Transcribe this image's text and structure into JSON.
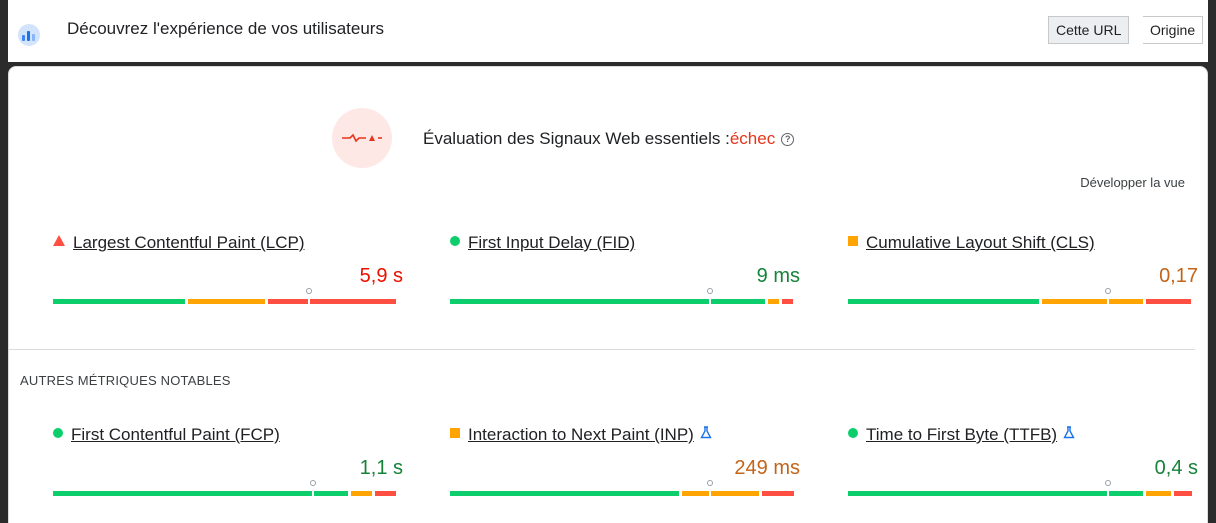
{
  "header": {
    "title": "Découvrez l'expérience de vos utilisateurs",
    "toggle": {
      "this_url": "Cette URL",
      "origin": "Origine",
      "active": "this_url"
    }
  },
  "assessment": {
    "label": "Évaluation des Signaux Web essentiels :",
    "result": "échec",
    "expand": "Développer la vue"
  },
  "core_metrics": [
    {
      "name": "Largest Contentful Paint (LCP)",
      "value": "5,9 s",
      "rating": "poor",
      "marker": "triangle",
      "experimental": false,
      "distribution": {
        "good": 0.39,
        "average": 0.23,
        "poor": 0.38
      },
      "p75": 0.74
    },
    {
      "name": "First Input Delay (FID)",
      "value": "9 ms",
      "rating": "good",
      "marker": "circle",
      "experimental": false,
      "distribution": {
        "good": 0.92,
        "average": 0.04,
        "poor": 0.04
      },
      "p75": 0.75
    },
    {
      "name": "Cumulative Layout Shift (CLS)",
      "value": "0,17",
      "rating": "average",
      "marker": "square",
      "experimental": false,
      "distribution": {
        "good": 0.56,
        "average": 0.3,
        "poor": 0.14
      },
      "p75": 0.75
    }
  ],
  "other_section_label": "AUTRES MÉTRIQUES NOTABLES",
  "other_metrics": [
    {
      "name": "First Contentful Paint (FCP)",
      "value": "1,1 s",
      "rating": "good",
      "marker": "circle",
      "experimental": false,
      "distribution": {
        "good": 0.86,
        "average": 0.07,
        "poor": 0.07
      },
      "p75": 0.75
    },
    {
      "name": "Interaction to Next Paint (INP)",
      "value": "249 ms",
      "rating": "average",
      "marker": "square",
      "experimental": true,
      "distribution": {
        "good": 0.67,
        "average": 0.23,
        "poor": 0.1
      },
      "p75": 0.75
    },
    {
      "name": "Time to First Byte (TTFB)",
      "value": "0,4 s",
      "rating": "good",
      "marker": "circle",
      "experimental": true,
      "distribution": {
        "good": 0.86,
        "average": 0.08,
        "poor": 0.06
      },
      "p75": 0.75
    }
  ],
  "icons": {
    "report_logo": "crux-report-icon",
    "assessment": "pulse-fail-icon",
    "help": "help-icon",
    "experimental": "flask-icon"
  },
  "colors": {
    "good": "#0cce6b",
    "average": "#ffa400",
    "poor": "#ff4e42",
    "fail_text": "#e8341c",
    "good_text": "#178239",
    "average_text": "#c2641a",
    "poor_text": "#eb0f00"
  }
}
